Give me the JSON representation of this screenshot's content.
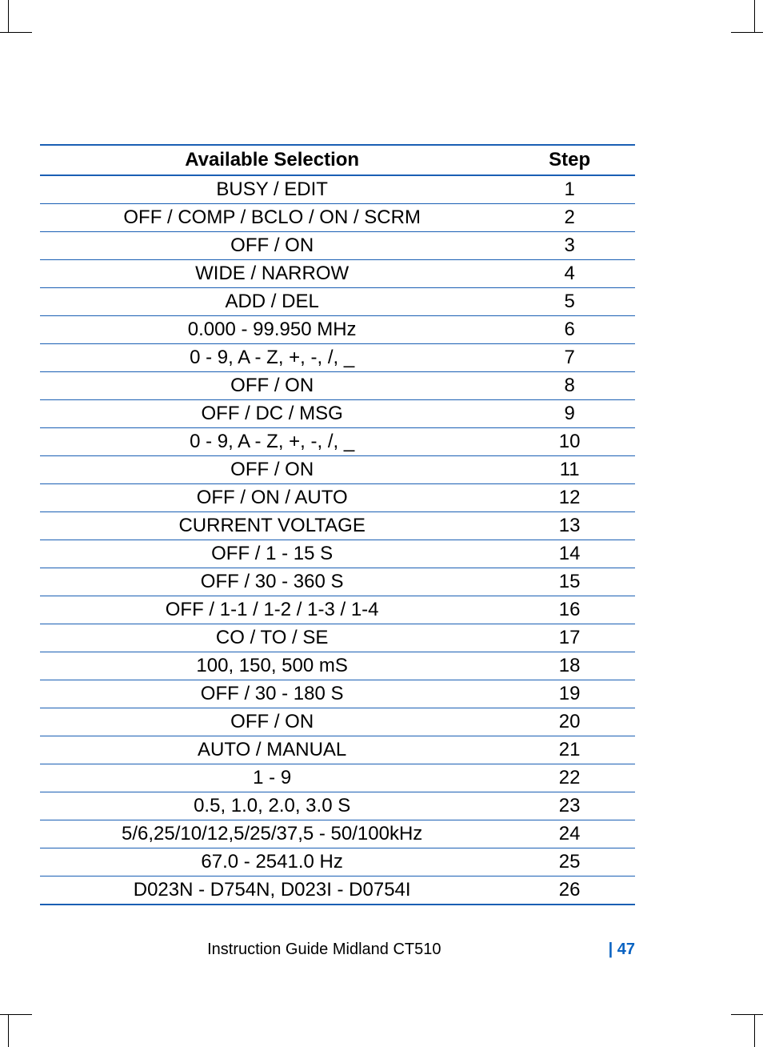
{
  "table": {
    "headers": {
      "selection": "Available Selection",
      "step": "Step"
    },
    "rows": [
      {
        "selection": "BUSY / EDIT",
        "step": "1"
      },
      {
        "selection": "OFF / COMP / BCLO / ON / SCRM",
        "step": "2"
      },
      {
        "selection": "OFF / ON",
        "step": "3"
      },
      {
        "selection": "WIDE / NARROW",
        "step": "4"
      },
      {
        "selection": "ADD / DEL",
        "step": "5"
      },
      {
        "selection": "0.000 - 99.950 MHz",
        "step": "6"
      },
      {
        "selection": "0 - 9, A - Z, +, -, /, _",
        "step": "7"
      },
      {
        "selection": "OFF / ON",
        "step": "8"
      },
      {
        "selection": "OFF / DC / MSG",
        "step": "9"
      },
      {
        "selection": "0 - 9, A - Z, +, -, /, _",
        "step": "10"
      },
      {
        "selection": "OFF / ON",
        "step": "11"
      },
      {
        "selection": "OFF / ON / AUTO",
        "step": "12"
      },
      {
        "selection": "CURRENT VOLTAGE",
        "step": "13"
      },
      {
        "selection": "OFF / 1 - 15 S",
        "step": "14"
      },
      {
        "selection": "OFF / 30 - 360 S",
        "step": "15"
      },
      {
        "selection": "OFF / 1-1 / 1-2 / 1-3 / 1-4",
        "step": "16"
      },
      {
        "selection": "CO / TO / SE",
        "step": "17"
      },
      {
        "selection": "100, 150, 500 mS",
        "step": "18"
      },
      {
        "selection": "OFF / 30 - 180 S",
        "step": "19"
      },
      {
        "selection": "OFF / ON",
        "step": "20"
      },
      {
        "selection": "AUTO / MANUAL",
        "step": "21"
      },
      {
        "selection": "1 - 9",
        "step": "22"
      },
      {
        "selection": "0.5, 1.0, 2.0, 3.0 S",
        "step": "23"
      },
      {
        "selection": "5/6,25/10/12,5/25/37,5 - 50/100kHz",
        "step": "24"
      },
      {
        "selection": "67.0 - 2541.0 Hz",
        "step": "25"
      },
      {
        "selection": "D023N - D754N, D023I - D0754I",
        "step": "26"
      }
    ]
  },
  "footer": {
    "title": "Instruction Guide Midland CT510",
    "page_prefix": "| ",
    "page_number": "47"
  }
}
